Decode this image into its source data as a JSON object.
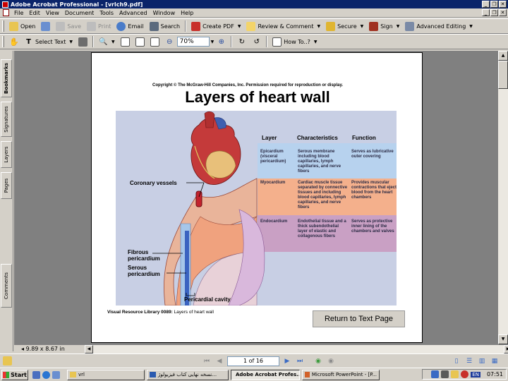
{
  "window": {
    "title": "Adobe Acrobat Professional - [vrlch9.pdf]",
    "controls": [
      "_",
      "❐",
      "✕"
    ]
  },
  "menu": [
    "File",
    "Edit",
    "View",
    "Document",
    "Tools",
    "Advanced",
    "Window",
    "Help"
  ],
  "toolbar1": {
    "open": "Open",
    "save": "Save",
    "print": "Print",
    "email": "Email",
    "search": "Search",
    "create_pdf": "Create PDF",
    "review": "Review & Comment",
    "secure": "Secure",
    "sign": "Sign",
    "advanced_editing": "Advanced Editing"
  },
  "toolbar2": {
    "select_text": "Select Text",
    "zoom": "70%",
    "how_to": "How To..?"
  },
  "side_tabs": [
    "Bookmarks",
    "Signatures",
    "Layers",
    "Pages",
    "Comments"
  ],
  "page": {
    "copyright": "Copyright © The McGraw-Hill Companies, Inc. Permission required for reproduction or display.",
    "title": "Layers of heart wall",
    "headers": {
      "layer": "Layer",
      "characteristics": "Characteristics",
      "function": "Function"
    },
    "rows": [
      {
        "layer": "Epicardium (visceral pericardium)",
        "characteristics": "Serous membrane including blood capillaries, lymph capillaries, and nerve fibers",
        "function": "Serves as lubricative outer covering"
      },
      {
        "layer": "Myocardium",
        "characteristics": "Cardiac muscle tissue separated by connective tissues and including blood capillaries, lymph capillaries, and nerve fibers",
        "function": "Provides muscular contractions that eject blood from the heart chambers"
      },
      {
        "layer": "Endocardium",
        "characteristics": "Endothelial tissue and a thick subendothelial layer of elastic and collagenous fibers",
        "function": "Serves as protective inner lining of the chambers and valves"
      }
    ],
    "figure_labels": {
      "coronary": "Coronary vessels",
      "fibrous": "Fibrous pericardium",
      "serous": "Serous pericardium",
      "cavity": "Pericardial cavity"
    },
    "caption_bold": "Visual Resource Library 0089:",
    "caption_text": "Layers of heart wall",
    "return_button": "Return to Text Page",
    "colors": {
      "epicardium": "#b7d2ee",
      "myocardium": "#f4b08c",
      "endocardium": "#c9a0c4"
    }
  },
  "status": {
    "page_size": "9.89 x 8.67 in",
    "page_indicator": "1 of 16"
  },
  "taskbar": {
    "start": "Start",
    "tasks": [
      "vrl",
      "نسخه نهایی کتاب فیزیولوژ...",
      "Adobe Acrobat Profes...",
      "Microsoft PowerPoint - [P..."
    ],
    "lang": "EN",
    "clock": "07:51"
  }
}
